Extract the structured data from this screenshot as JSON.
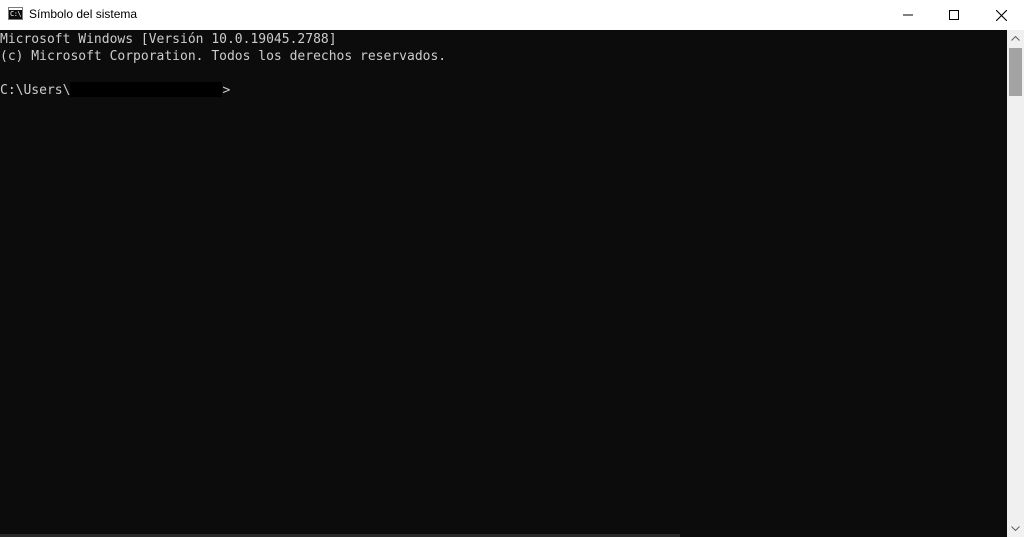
{
  "window": {
    "title": "Símbolo del sistema",
    "icon": "cmd-icon",
    "icon_glyph": "C:\\"
  },
  "controls": {
    "minimize": "minimize-icon",
    "maximize": "maximize-icon",
    "close": "close-icon"
  },
  "console": {
    "line1": "Microsoft Windows [Versión 10.0.19045.2788]",
    "line2": "(c) Microsoft Corporation. Todos los derechos reservados.",
    "prompt_prefix": "C:\\Users\\",
    "prompt_suffix": ">",
    "text_color": "#cccccc",
    "background_color": "#0c0c0c"
  }
}
